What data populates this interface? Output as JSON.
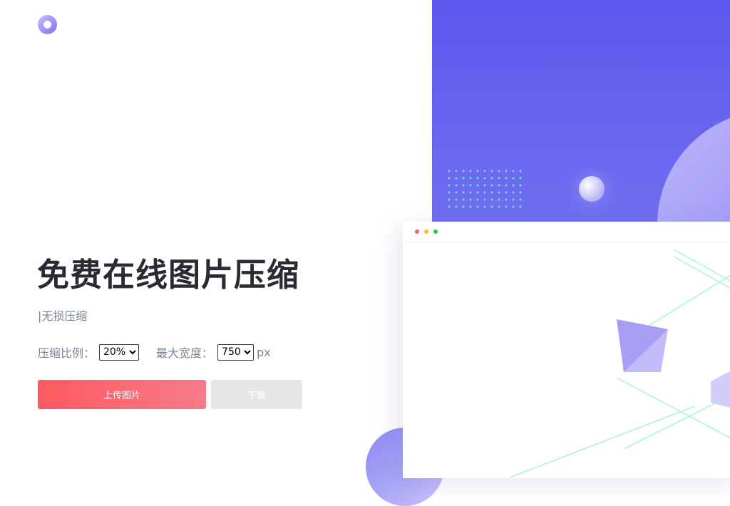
{
  "header": {
    "logo": "logo-ring-icon"
  },
  "hero": {
    "title": "免费在线图片压缩",
    "subtitle": "|无损压缩"
  },
  "options": {
    "ratio_label": "压缩比例：",
    "ratio_value": "20%",
    "width_label": "最大宽度：",
    "width_value": "750",
    "width_unit": "px"
  },
  "buttons": {
    "upload": "上传图片",
    "download": "下载"
  },
  "colors": {
    "accent_purple": "#5d58ee",
    "upload_red": "#ff5a5f",
    "download_gray": "#e6e6e6",
    "dots_green": "#6ff0d2"
  }
}
